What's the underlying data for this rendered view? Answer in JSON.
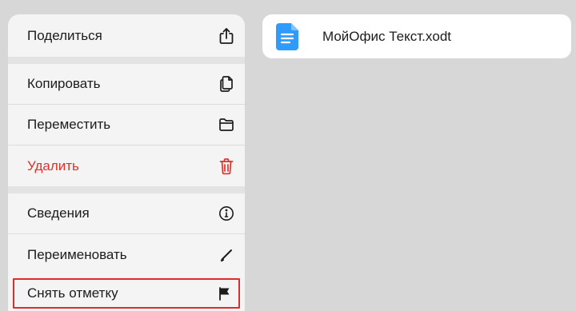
{
  "menu": {
    "items": [
      {
        "label": "Поделиться",
        "icon": "share-icon"
      },
      {
        "label": "Копировать",
        "icon": "copy-icon"
      },
      {
        "label": "Переместить",
        "icon": "folder-icon"
      },
      {
        "label": "Удалить",
        "icon": "trash-icon"
      },
      {
        "label": "Сведения",
        "icon": "info-icon"
      },
      {
        "label": "Переименовать",
        "icon": "pencil-icon"
      },
      {
        "label": "Снять отметку",
        "icon": "flag-icon"
      }
    ]
  },
  "file": {
    "name": "МойОфис Текст.xodt",
    "icon": "text-document-icon"
  },
  "colors": {
    "danger": "#e0312b",
    "highlight_border": "#e02b2b",
    "doc_blue": "#2f9bff"
  }
}
